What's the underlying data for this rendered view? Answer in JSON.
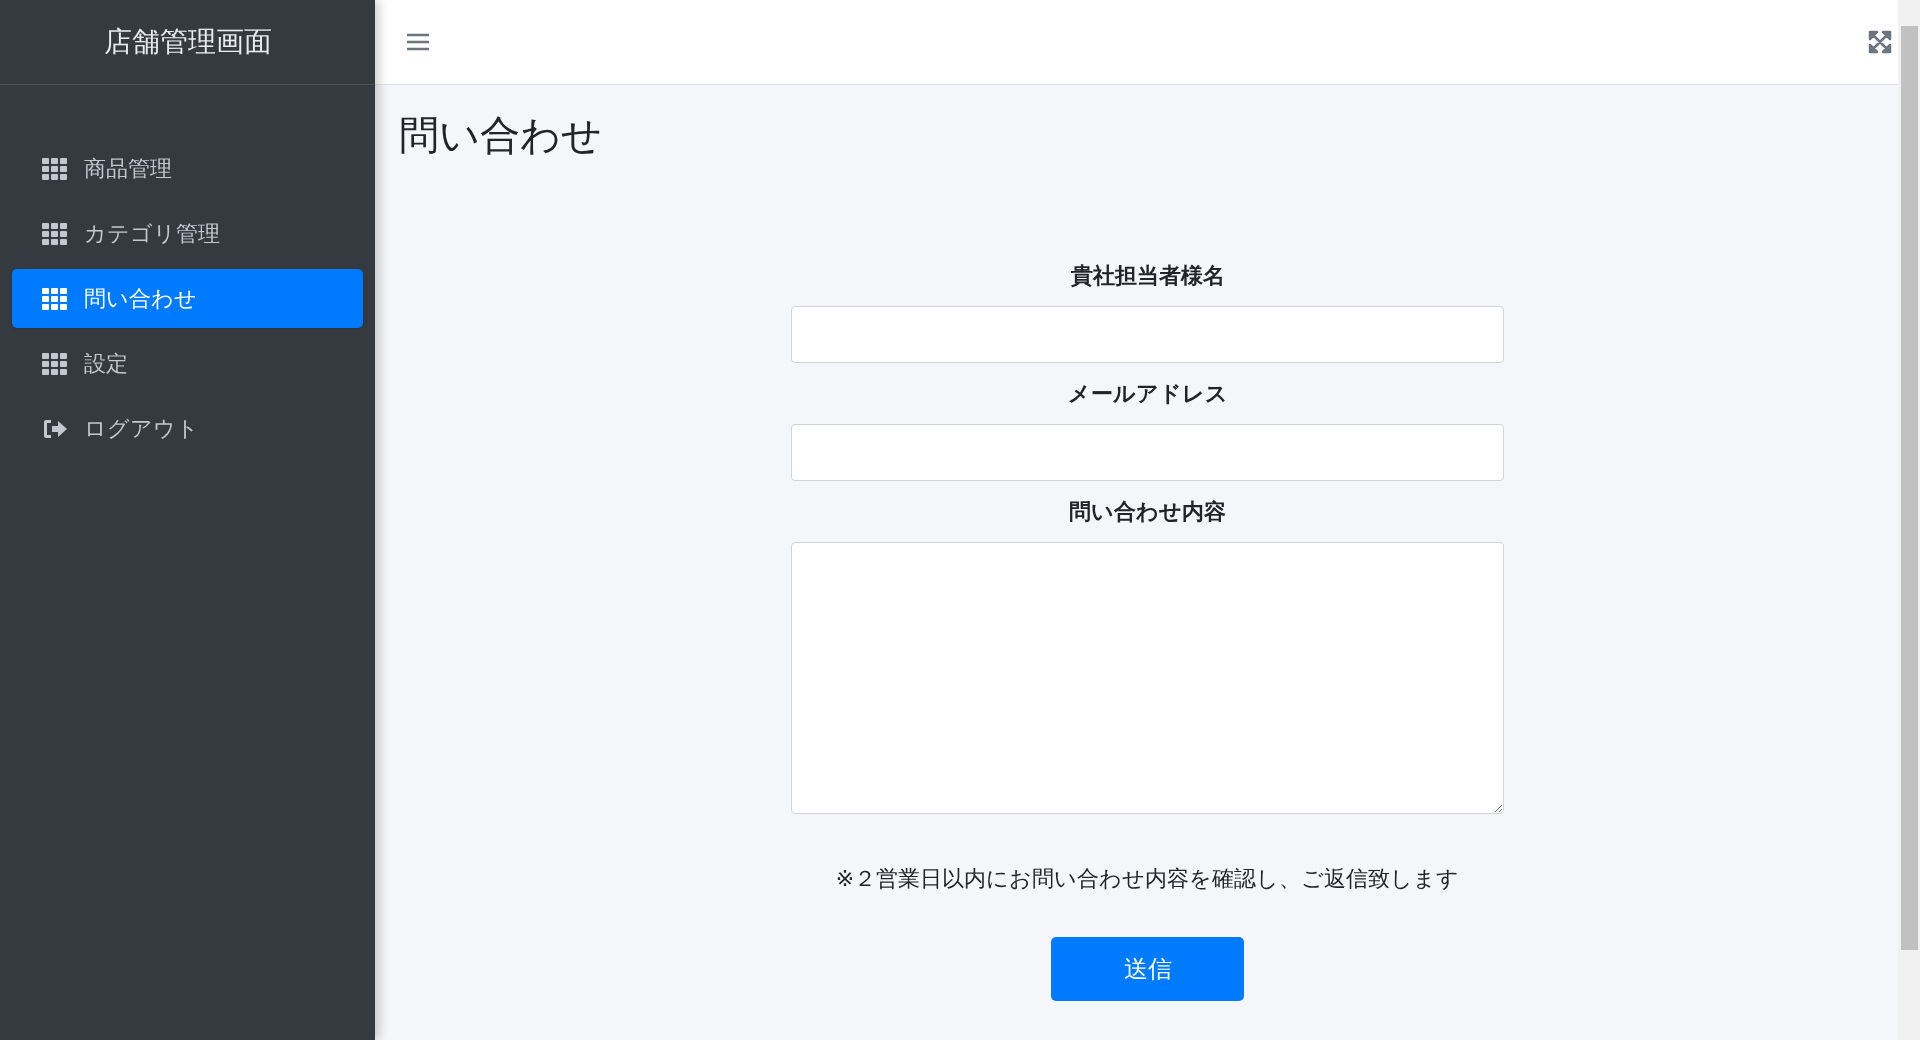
{
  "sidebar": {
    "title": "店舗管理画面",
    "items": [
      {
        "label": "商品管理",
        "kind": "grid",
        "selected": false
      },
      {
        "label": "カテゴリ管理",
        "kind": "grid",
        "selected": false
      },
      {
        "label": "問い合わせ",
        "kind": "grid",
        "selected": true
      },
      {
        "label": "設定",
        "kind": "grid",
        "selected": false
      },
      {
        "label": "ログアウト",
        "kind": "logout",
        "selected": false
      }
    ]
  },
  "page": {
    "title": "問い合わせ"
  },
  "form": {
    "fields": [
      {
        "label": "貴社担当者様名",
        "kind": "input"
      },
      {
        "label": "メールアドレス",
        "kind": "input"
      },
      {
        "label": "問い合わせ内容",
        "kind": "textarea"
      }
    ],
    "note": "※２営業日以内にお問い合わせ内容を確認し、ご返信致します",
    "submit": "送信"
  }
}
